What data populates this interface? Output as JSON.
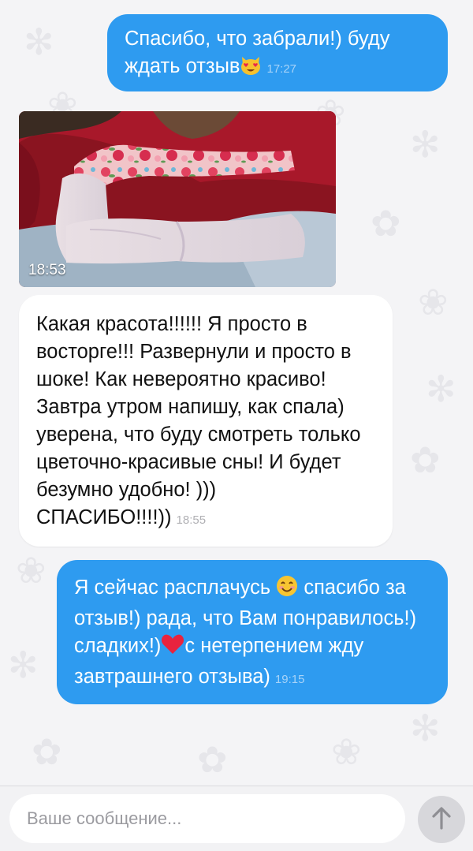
{
  "messages": [
    {
      "direction": "outgoing",
      "text": "Спасибо, что забрали!) буду ждать отзыв",
      "emoji": "heart-eyes-cat-emoji",
      "time": "17:27"
    },
    {
      "direction": "incoming",
      "type": "photo",
      "subject": "floral U-shaped pregnancy pillow on bed",
      "time": "18:53"
    },
    {
      "direction": "incoming",
      "text": "Какая красота!!!!!! Я просто в восторге!!! Развернули и просто в шоке! Как невероятно красиво! Завтра утром напишу, как спала) уверена, что буду смотреть только цветочно-красивые сны! И будет безумно удобно! ))) СПАСИБО!!!!))",
      "time": "18:55"
    },
    {
      "direction": "outgoing",
      "text_a": "Я сейчас расплачусь",
      "emoji_a": "smiling-face-emoji",
      "text_b": "спасибо за отзыв!) рада, что Вам понравилось!) сладких!)",
      "emoji_b": "red-heart-emoji",
      "text_c": "с нетерпением жду завтрашнего отзыва)",
      "time": "19:15"
    }
  ],
  "composer": {
    "placeholder": "Ваше сообщение...",
    "send_icon": "arrow-up-icon"
  },
  "colors": {
    "outgoing_bubble": "#2e9bf0",
    "incoming_bubble": "#ffffff",
    "background": "#f4f4f6"
  }
}
